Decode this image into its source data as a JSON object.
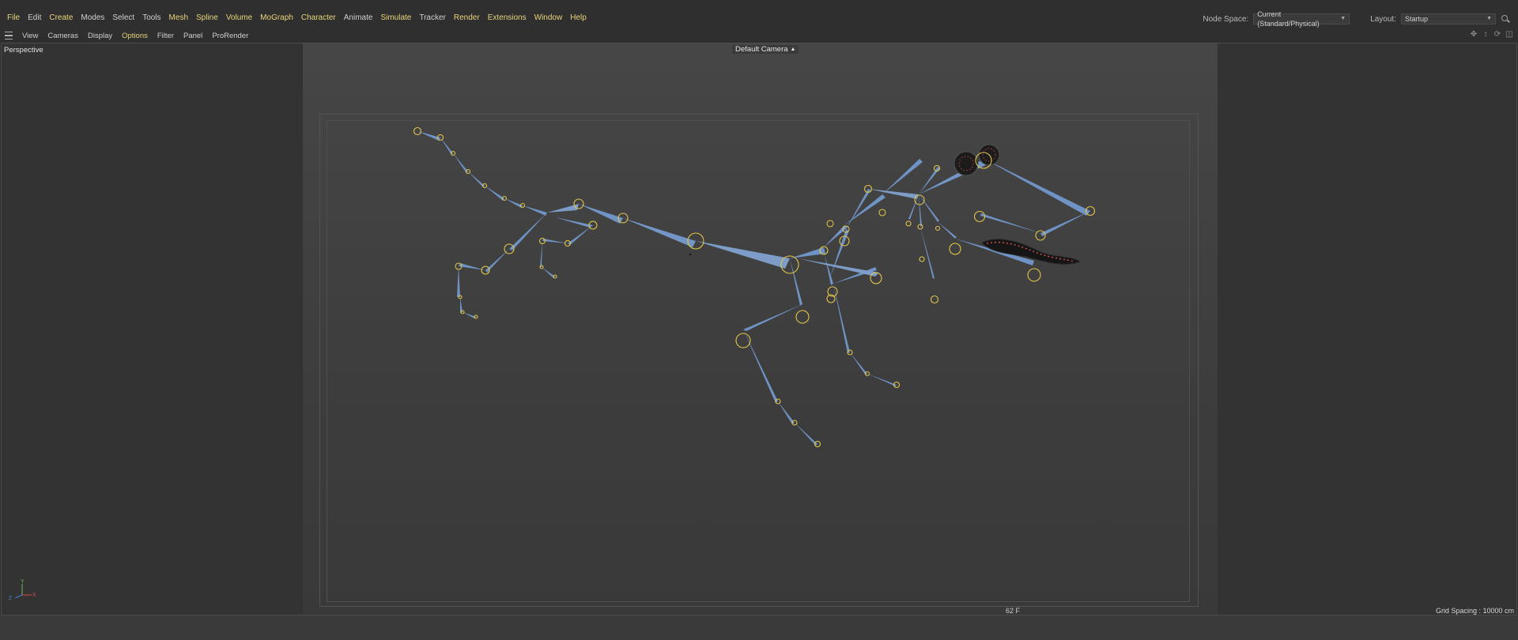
{
  "menubar": {
    "items": [
      {
        "label": "File",
        "accent": true
      },
      {
        "label": "Edit",
        "accent": false
      },
      {
        "label": "Create",
        "accent": true
      },
      {
        "label": "Modes",
        "accent": false
      },
      {
        "label": "Select",
        "accent": false
      },
      {
        "label": "Tools",
        "accent": false
      },
      {
        "label": "Mesh",
        "accent": true
      },
      {
        "label": "Spline",
        "accent": true
      },
      {
        "label": "Volume",
        "accent": true
      },
      {
        "label": "MoGraph",
        "accent": true
      },
      {
        "label": "Character",
        "accent": true
      },
      {
        "label": "Animate",
        "accent": false
      },
      {
        "label": "Simulate",
        "accent": true
      },
      {
        "label": "Tracker",
        "accent": false
      },
      {
        "label": "Render",
        "accent": true
      },
      {
        "label": "Extensions",
        "accent": true
      },
      {
        "label": "Window",
        "accent": true
      },
      {
        "label": "Help",
        "accent": true
      }
    ],
    "node_space_label": "Node Space:",
    "node_space_value": "Current (Standard/Physical)",
    "layout_label": "Layout:",
    "layout_value": "Startup"
  },
  "viewmenu": {
    "items": [
      {
        "label": "View",
        "accent": false
      },
      {
        "label": "Cameras",
        "accent": false
      },
      {
        "label": "Display",
        "accent": false
      },
      {
        "label": "Options",
        "accent": true
      },
      {
        "label": "Filter",
        "accent": false
      },
      {
        "label": "Panel",
        "accent": false
      },
      {
        "label": "ProRender",
        "accent": false
      }
    ],
    "icons": [
      "move-icon",
      "zoom-icon",
      "rotate-icon",
      "layout-icon"
    ]
  },
  "viewport": {
    "view_name": "Perspective",
    "camera_label": "Default Camera",
    "frame_label": "62 F",
    "grid_spacing": "Grid Spacing : 10000 cm",
    "axis_labels": {
      "y": "Y",
      "z": "Z",
      "x": "X"
    }
  },
  "colors": {
    "accent": "#e8d47a",
    "bone": "#6f93c4",
    "joint": "#e2c64a",
    "axis_x": "#d64a4a",
    "axis_y": "#5cc45c",
    "axis_z": "#4a7fd6"
  }
}
